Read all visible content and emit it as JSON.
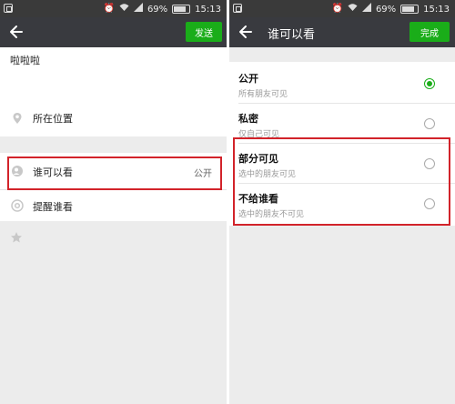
{
  "status_bar": {
    "battery": "69%",
    "time": "15:13"
  },
  "left_screen": {
    "send_button": "发送",
    "post_text": "啦啦啦",
    "location_label": "所在位置",
    "visibility_label": "谁可以看",
    "visibility_value": "公开",
    "remind_label": "提醒谁看"
  },
  "right_screen": {
    "title": "谁可以看",
    "done_button": "完成",
    "options": [
      {
        "label": "公开",
        "sub": "所有朋友可见",
        "selected": true
      },
      {
        "label": "私密",
        "sub": "仅自己可见",
        "selected": false
      },
      {
        "label": "部分可见",
        "sub": "选中的朋友可见",
        "selected": false
      },
      {
        "label": "不给谁看",
        "sub": "选中的朋友不可见",
        "selected": false
      }
    ]
  },
  "colors": {
    "accent_green": "#1aad19",
    "titlebar": "#393a3f",
    "highlight_red": "#d2232a"
  },
  "icons": [
    "back-arrow-icon",
    "location-pin-icon",
    "people-icon",
    "at-icon",
    "star-icon",
    "alarm-icon",
    "wifi-icon",
    "signal-icon",
    "battery-icon"
  ]
}
